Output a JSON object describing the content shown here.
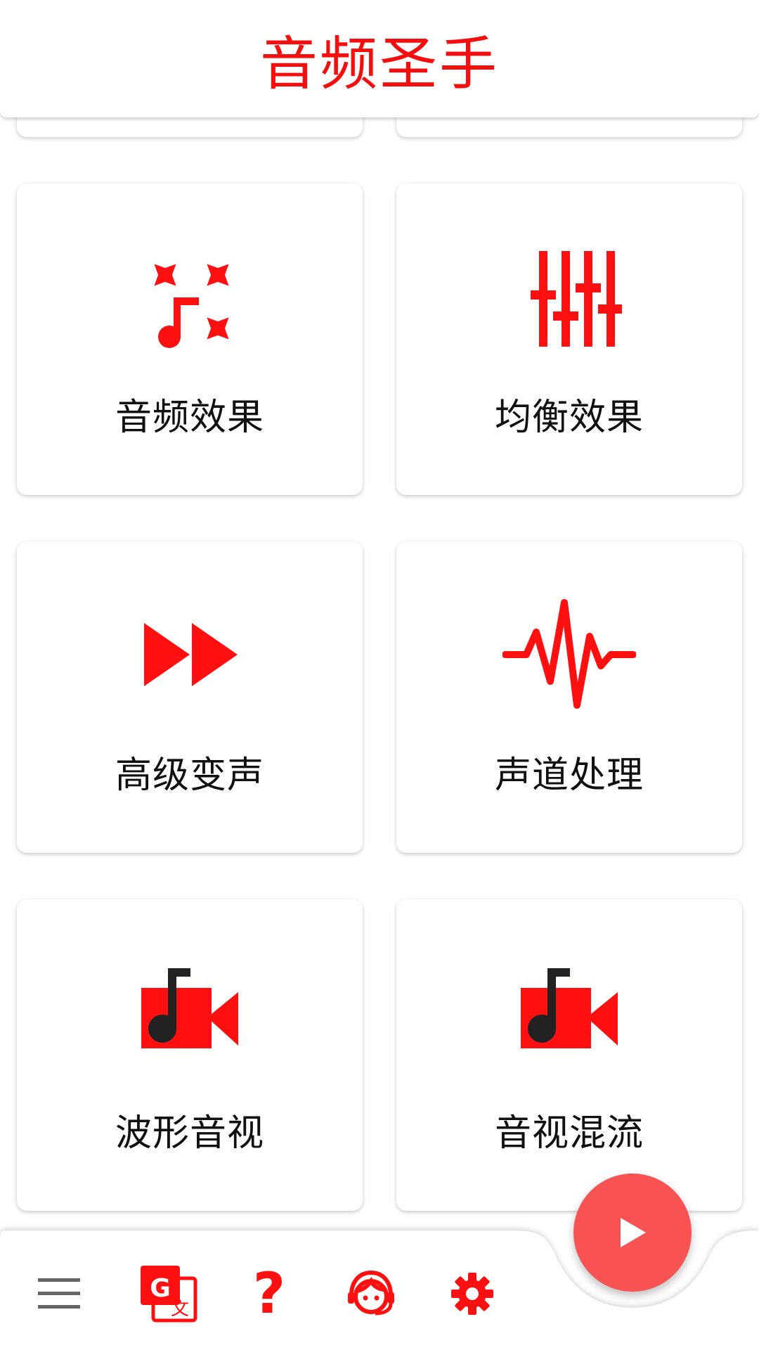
{
  "app": {
    "title": "音频圣手"
  },
  "colors": {
    "accent": "#ff1010",
    "fab": "#f85252",
    "text": "#111111"
  },
  "cards": [
    {
      "label": "音频效果",
      "icon": "sparkle-music-icon"
    },
    {
      "label": "均衡效果",
      "icon": "equalizer-icon"
    },
    {
      "label": "高级变声",
      "icon": "fast-forward-icon"
    },
    {
      "label": "声道处理",
      "icon": "waveform-icon"
    },
    {
      "label": "波形音视",
      "icon": "music-video-icon"
    },
    {
      "label": "音视混流",
      "icon": "music-video-icon"
    }
  ],
  "bottom_nav": [
    {
      "icon": "menu-icon"
    },
    {
      "icon": "translate-icon"
    },
    {
      "icon": "help-icon",
      "glyph": "?"
    },
    {
      "icon": "support-agent-icon"
    },
    {
      "icon": "settings-icon"
    }
  ],
  "fab": {
    "icon": "play-icon"
  }
}
